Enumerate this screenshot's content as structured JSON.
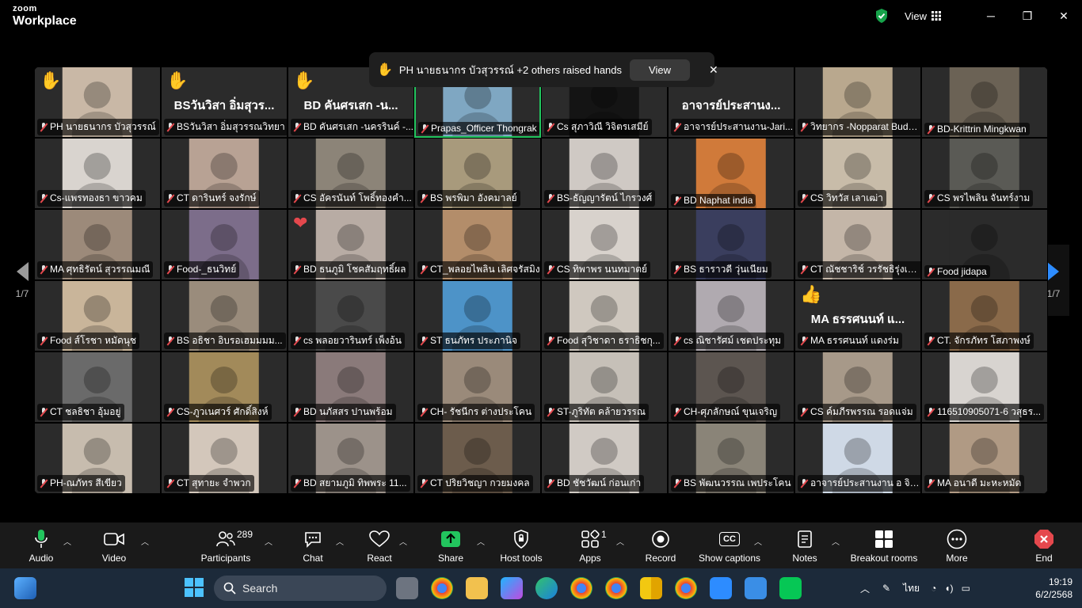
{
  "app": {
    "brand_top": "zoom",
    "brand_bottom": "Workplace",
    "view_label": "View"
  },
  "notification": {
    "text": "PH นายธนากร บัวสุวรรณ์ +2 others raised hands",
    "view_label": "View",
    "close": "✕"
  },
  "pager": {
    "left": "1/7",
    "right": "1/7"
  },
  "tiles": [
    {
      "name": "PH นายธนากร บัวสุวรรณ์",
      "hand": "✋",
      "color": "#c9b8a6"
    },
    {
      "name": "BSวันวิสา อิ่มสุวรรณวิทยา",
      "hand": "✋",
      "big": "BSวันวิสา อิ่มสุวร...",
      "color": "#2b2b2b"
    },
    {
      "name": "BD คันศรเสก -นครรินค์ -...",
      "hand": "✋",
      "big": "BD คันศรเสก -น...",
      "color": "#2b2b2b"
    },
    {
      "name": "Prapas_Officer Thongrak",
      "active": true,
      "color": "#7fa7c2"
    },
    {
      "name": "Cs สุภาวิณี วิจิตรเสมีย์",
      "color": "#141414"
    },
    {
      "name": "อาจารย์ประสานงาน-Jari...",
      "big": "อาจารย์ประสานง...",
      "color": "#2b2b2b"
    },
    {
      "name": "วิทยากร -Nopparat Budd...",
      "color": "#b9a88e"
    },
    {
      "name": "BD-Krittrin Mingkwan",
      "color": "#6b6255"
    },
    {
      "name": "Cs-แพรทองธา ขาวคม",
      "color": "#d9d4cf"
    },
    {
      "name": "CT ดารินทร์ จงรักษ์",
      "color": "#b8a294"
    },
    {
      "name": "CS อัครนันท์ โพธิ์ทองคำ...",
      "color": "#8c8478"
    },
    {
      "name": "BS พรพิมา อังคมาลย์",
      "color": "#a89a7c"
    },
    {
      "name": "BS-ธัญญารัตน์ ไกรวงศ์",
      "color": "#cfc9c4"
    },
    {
      "name": "BD Naphat india",
      "color": "#d07a3a"
    },
    {
      "name": "CS วิทวัส เลาเฒ่า",
      "color": "#c8bca9"
    },
    {
      "name": "CS พรไพลิน จันทร์งาม",
      "color": "#5a5a55"
    },
    {
      "name": "MA ศุทธิรัตน์ สุวรรณมณี",
      "color": "#9c8a7a"
    },
    {
      "name": "Food-_ธนวิทย์",
      "color": "#7c6d8a"
    },
    {
      "name": "BD ธนภูมิ โชคสัมฤทธิ์ผล",
      "heart": "❤",
      "color": "#b8aca4"
    },
    {
      "name": "CT_พลอยไพลิน เลิศจรัสมิง",
      "color": "#b38d6a"
    },
    {
      "name": "CS ทิพาพร นนทมาตย์",
      "color": "#d8d2cc"
    },
    {
      "name": "BS ธาราวดี วุ่นเนียม",
      "color": "#3a3e5e"
    },
    {
      "name": "CT ณัชชาริช์ วรรัชธิรุ่งเจ...",
      "color": "#c4b6a8"
    },
    {
      "name": "Food jidapa",
      "color": "#2b2b2b"
    },
    {
      "name": "Food ส์โรชา หมัดนุช",
      "color": "#c9b59a"
    },
    {
      "name": "BS อธิชา อิบรอเฮมมมม...",
      "color": "#9a8c7c"
    },
    {
      "name": "cs พลอยวารินทร์ เพ็งอ้น",
      "color": "#4a4a4a"
    },
    {
      "name": "ST ธนภัทร ประภานิจ",
      "color": "#4d93c8"
    },
    {
      "name": "Food สุวิชาดา ธราธิชกุ...",
      "color": "#cfc8bf"
    },
    {
      "name": "cs ณิชารัศม์ เชตประทุม",
      "color": "#b0aab0"
    },
    {
      "name": "MA ธรรศนนท์ แดงร่ม",
      "thumb": "👍",
      "big": "MA ธรรศนนท์ แ...",
      "color": "#2b2b2b"
    },
    {
      "name": "CT. จักรภัทร โสภาพงษ์",
      "color": "#8a6a4a"
    },
    {
      "name": "CT ชลธิชา อุ้มอยู่",
      "color": "#6a6a6a"
    },
    {
      "name": "CS-ภูวเนศวร์ ศักดิ์สิงห์",
      "color": "#a28a5a"
    },
    {
      "name": "BD นภัสสร ปานพร้อม",
      "color": "#8a7a7a"
    },
    {
      "name": "CH- รัชนีกร ต่างประโคน",
      "color": "#9a8a7a"
    },
    {
      "name": "ST-ภูริทัต คล้ายวรรณ",
      "color": "#c6c0b8"
    },
    {
      "name": "CH-ศุภลักษณ์ ขุนเจริญ",
      "color": "#5c5550"
    },
    {
      "name": "CS ค์มภีรพรรณ รอดแจ่ม",
      "color": "#a79989"
    },
    {
      "name": "116510905071-6 วสุธร...",
      "color": "#d8d4d0"
    },
    {
      "name": "PH-ณภัทร สีเขียว",
      "color": "#c7bcae"
    },
    {
      "name": "CT สุทายะ จำพวก",
      "color": "#d3c7bb"
    },
    {
      "name": "BD สยามภูมิ ทิพพระ 11...",
      "color": "#9c928a"
    },
    {
      "name": "CT ปริยวิชญา กวยมงคล",
      "color": "#6c5c4c"
    },
    {
      "name": "BD ชัชวัฒน์ ก่อนเก่า",
      "color": "#d0cac4"
    },
    {
      "name": "BS พัฒนวรรณ เพประโคน",
      "color": "#8a8478"
    },
    {
      "name": "อาจารย์ประสานงาน อ จิร...",
      "color": "#cfd9e6"
    },
    {
      "name": "MA อนาดี มะหะหมัด",
      "color": "#b09a84"
    }
  ],
  "toolbar": {
    "audio": "Audio",
    "video": "Video",
    "participants": "Participants",
    "participants_count": "289",
    "chat": "Chat",
    "react": "React",
    "share": "Share",
    "host_tools": "Host tools",
    "apps": "Apps",
    "apps_count": "1",
    "record": "Record",
    "captions": "Show captions",
    "captions_badge": "CC",
    "notes": "Notes",
    "breakout": "Breakout rooms",
    "more": "More",
    "end": "End"
  },
  "taskbar": {
    "search": "Search",
    "lang": "ไทย",
    "time": "19:19",
    "date": "6/2/2568"
  },
  "colors": {
    "end_red": "#e5484d",
    "share_green": "#22c55e",
    "nav_blue": "#2d8cff",
    "shield_green": "#16a34a"
  }
}
